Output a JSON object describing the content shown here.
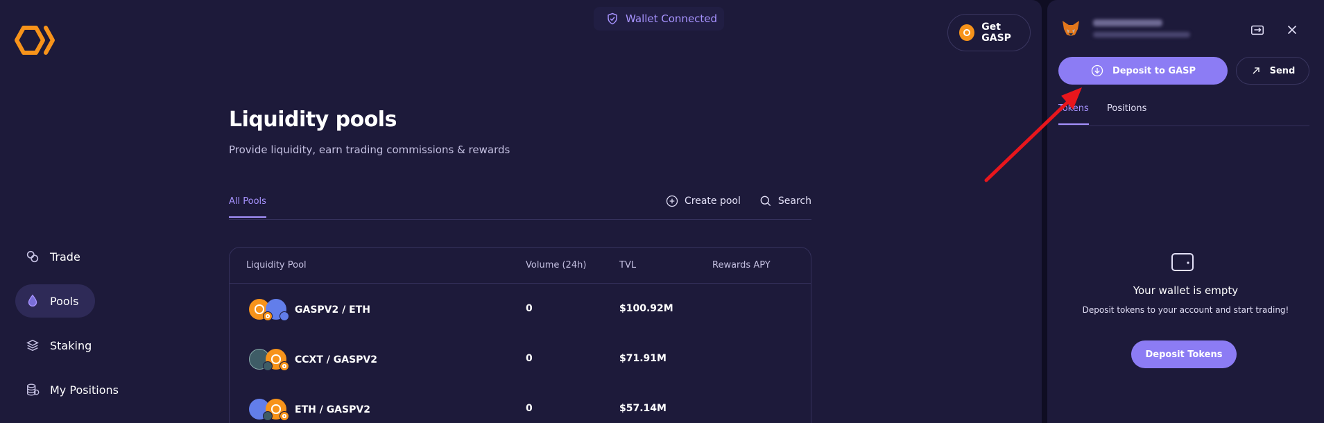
{
  "header": {
    "wallet_status": "Wallet Connected",
    "get_gasp_label": "Get GASP"
  },
  "nav": {
    "items": [
      {
        "label": "Trade",
        "icon": "trade-icon",
        "active": false
      },
      {
        "label": "Pools",
        "icon": "drop-icon",
        "active": true
      },
      {
        "label": "Staking",
        "icon": "layers-icon",
        "active": false
      },
      {
        "label": "My Positions",
        "icon": "coins-stack-icon",
        "active": false
      }
    ]
  },
  "main": {
    "title": "Liquidity pools",
    "subtitle": "Provide liquidity, earn trading commissions & rewards",
    "tab_all": "All Pools",
    "create_pool": "Create pool",
    "search": "Search",
    "columns": [
      "Liquidity Pool",
      "Volume (24h)",
      "TVL",
      "Rewards APY"
    ],
    "rows": [
      {
        "pair": "GASPV2 / ETH",
        "volume": "0",
        "tvl": "$100.92M",
        "apy": ""
      },
      {
        "pair": "CCXT / GASPV2",
        "volume": "0",
        "tvl": "$71.91M",
        "apy": ""
      },
      {
        "pair": "ETH / GASPV2",
        "volume": "0",
        "tvl": "$57.14M",
        "apy": ""
      }
    ]
  },
  "wallet": {
    "deposit_label": "Deposit to GASP",
    "send_label": "Send",
    "tab_tokens": "Tokens",
    "tab_positions": "Positions",
    "empty_title": "Your wallet is empty",
    "empty_sub": "Deposit tokens to your account and start trading!",
    "deposit_tokens_label": "Deposit Tokens"
  },
  "colors": {
    "accent": "#8c7cf4",
    "accent_text": "#a793ff",
    "gasp_orange": "#f7931a",
    "eth_blue": "#627eea",
    "annotation_red": "#e8161c"
  }
}
